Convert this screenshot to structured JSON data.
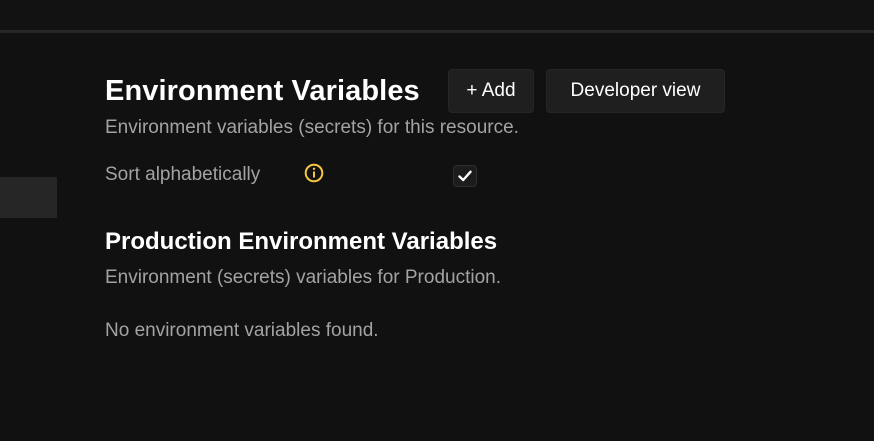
{
  "env_section": {
    "title": "Environment Variables",
    "subtitle": "Environment variables (secrets) for this resource.",
    "add_label": "+ Add",
    "developer_view_label": "Developer view",
    "sort_label": "Sort alphabetically",
    "sort_checked": true
  },
  "production_section": {
    "title": "Production Environment Variables",
    "subtitle": "Environment (secrets) variables for Production.",
    "empty_message": "No environment variables found."
  },
  "icons": {
    "info": "info-icon",
    "check": "check-icon"
  },
  "colors": {
    "background": "#111111",
    "text_primary": "#ffffff",
    "text_muted": "#a3a3a3",
    "button_bg": "#1f1f1f",
    "info_icon": "#f4c542"
  }
}
